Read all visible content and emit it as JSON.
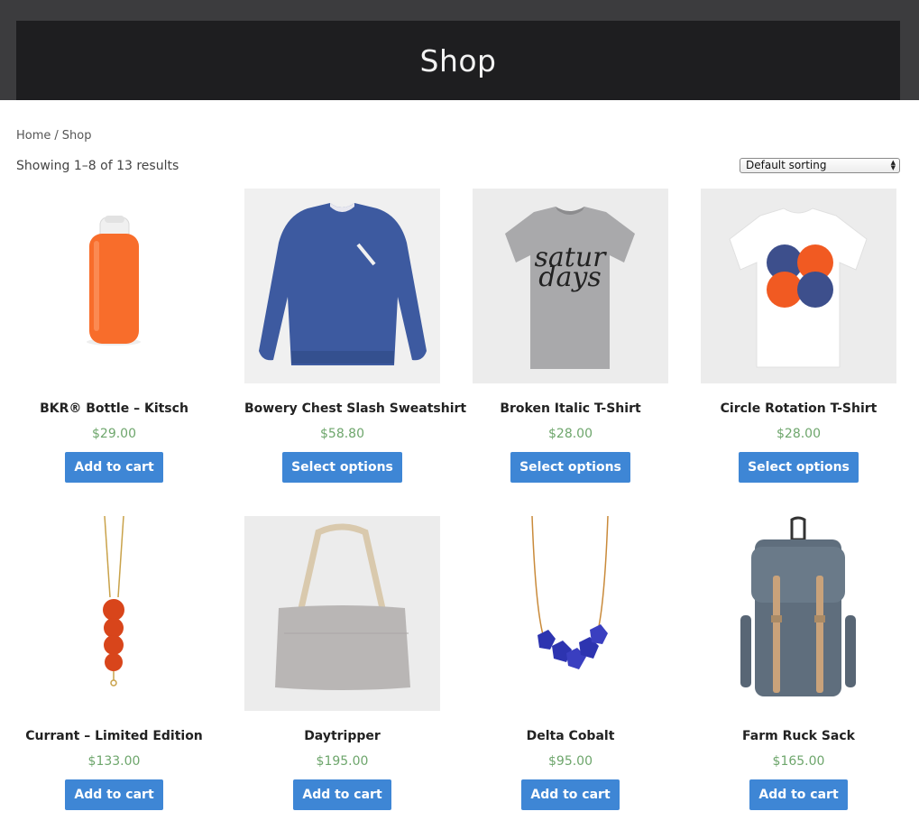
{
  "page": {
    "title": "Shop"
  },
  "breadcrumb": {
    "home": "Home",
    "separator": "/",
    "current": "Shop"
  },
  "results": {
    "text": "Showing 1–8 of 13 results"
  },
  "sorting": {
    "selected": "Default sorting"
  },
  "colors": {
    "header_bg": "#1e1e20",
    "price": "#6ea66c",
    "button": "#3e86d5"
  },
  "products": [
    {
      "name": "BKR® Bottle – Kitsch",
      "price": "$29.00",
      "button": "Add to cart",
      "image": "orange-bottle"
    },
    {
      "name": "Bowery Chest Slash Sweatshirt",
      "price": "$58.80",
      "button": "Select options",
      "image": "blue-sweatshirt"
    },
    {
      "name": "Broken Italic T-Shirt",
      "price": "$28.00",
      "button": "Select options",
      "image": "grey-tshirt"
    },
    {
      "name": "Circle Rotation T-Shirt",
      "price": "$28.00",
      "button": "Select options",
      "image": "white-tshirt"
    },
    {
      "name": "Currant – Limited Edition",
      "price": "$133.00",
      "button": "Add to cart",
      "image": "red-bead-necklace"
    },
    {
      "name": "Daytripper",
      "price": "$195.00",
      "button": "Add to cart",
      "image": "grey-tote-bag"
    },
    {
      "name": "Delta Cobalt",
      "price": "$95.00",
      "button": "Add to cart",
      "image": "cobalt-necklace"
    },
    {
      "name": "Farm Ruck Sack",
      "price": "$165.00",
      "button": "Add to cart",
      "image": "grey-backpack"
    }
  ]
}
